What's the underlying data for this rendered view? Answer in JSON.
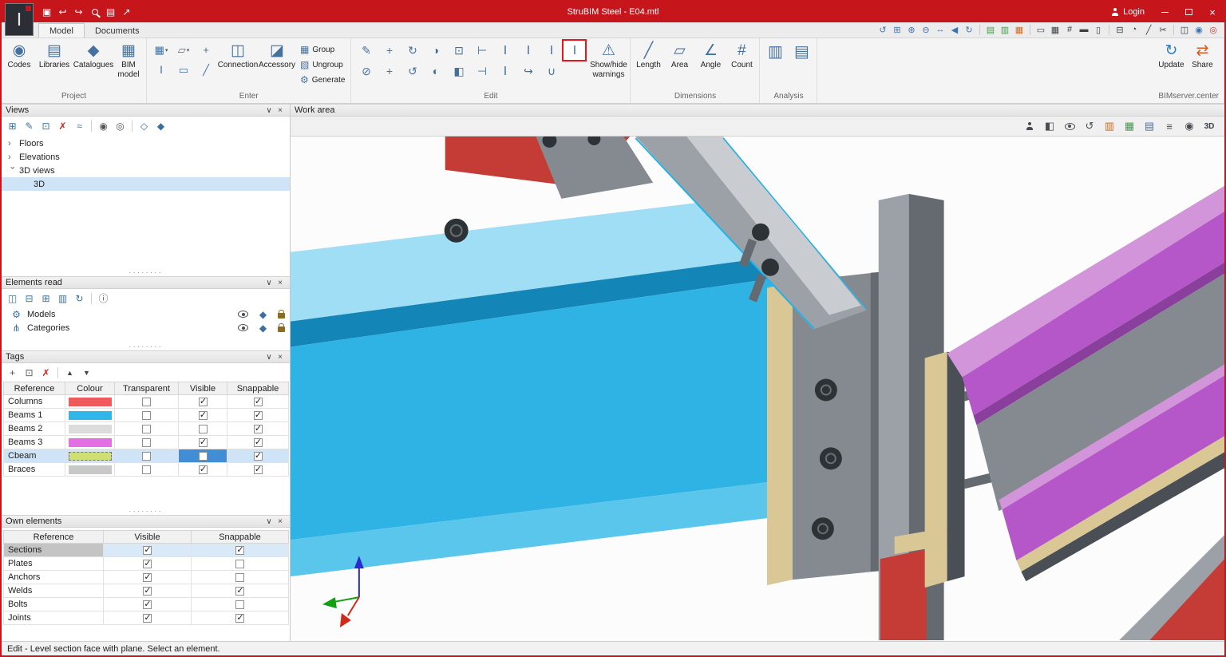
{
  "titlebar": {
    "title": "StruBIM Steel - E04.mtl",
    "login_label": "Login"
  },
  "tabs": {
    "model": "Model",
    "documents": "Documents"
  },
  "ribbon": {
    "project": {
      "label": "Project",
      "codes": "Codes",
      "libraries": "Libraries",
      "catalogues": "Catalogues",
      "bim_model": "BIM model"
    },
    "enter": {
      "label": "Enter",
      "connection": "Connection",
      "accessory": "Accessory",
      "group": "Group",
      "ungroup": "Ungroup",
      "generate": "Generate"
    },
    "edit": {
      "label": "Edit",
      "show_hide_warnings": "Show/hide warnings"
    },
    "dimensions": {
      "label": "Dimensions",
      "length": "Length",
      "area": "Area",
      "angle": "Angle",
      "count": "Count"
    },
    "analysis": {
      "label": "Analysis"
    },
    "bimserver": {
      "label": "BIMserver.center",
      "update": "Update",
      "share": "Share"
    }
  },
  "views_panel": {
    "title": "Views",
    "items": {
      "floors": "Floors",
      "elevations": "Elevations",
      "views3d": "3D views",
      "view3d": "3D"
    }
  },
  "elements_read_panel": {
    "title": "Elements read",
    "models": "Models",
    "categories": "Categories"
  },
  "tags_panel": {
    "title": "Tags",
    "columns": {
      "reference": "Reference",
      "colour": "Colour",
      "transparent": "Transparent",
      "visible": "Visible",
      "snappable": "Snappable"
    },
    "rows": [
      {
        "reference": "Columns",
        "colour": "#ef5a5c",
        "transparent": false,
        "visible": true,
        "snappable": true
      },
      {
        "reference": "Beams 1",
        "colour": "#2eb7e8",
        "transparent": false,
        "visible": true,
        "snappable": true
      },
      {
        "reference": "Beams 2",
        "colour": "#dcdcdc",
        "transparent": false,
        "visible": false,
        "snappable": true
      },
      {
        "reference": "Beams 3",
        "colour": "#e46fe4",
        "transparent": false,
        "visible": true,
        "snappable": true
      },
      {
        "reference": "Cbeam",
        "colour": "#cfe070",
        "transparent": false,
        "visible": false,
        "snappable": true
      },
      {
        "reference": "Braces",
        "colour": "#c8c8c8",
        "transparent": false,
        "visible": true,
        "snappable": true
      }
    ]
  },
  "own_elements_panel": {
    "title": "Own elements",
    "columns": {
      "reference": "Reference",
      "visible": "Visible",
      "snappable": "Snappable"
    },
    "rows": [
      {
        "reference": "Sections",
        "visible": true,
        "snappable": true
      },
      {
        "reference": "Plates",
        "visible": true,
        "snappable": false
      },
      {
        "reference": "Anchors",
        "visible": true,
        "snappable": false
      },
      {
        "reference": "Welds",
        "visible": true,
        "snappable": true
      },
      {
        "reference": "Bolts",
        "visible": true,
        "snappable": false
      },
      {
        "reference": "Joints",
        "visible": true,
        "snappable": true
      }
    ]
  },
  "workarea": {
    "title": "Work area",
    "view3d_label": "3D"
  },
  "statusbar": {
    "text": "Edit - Level section face with plane. Select an element."
  },
  "colors": {
    "titlebar": "#c6161c",
    "selection": "#cfe4f7",
    "cell_focus": "#418ed6",
    "row_current": "#c4c4c4",
    "row_current_rest": "#d9e9f7"
  },
  "viewport_colors": {
    "beam_top": "#9fdef4",
    "beam_shadow": "#1385b6",
    "beam_web": "#2fb3e4",
    "beam_bottom": "#5ac6ec",
    "plate_tan": "#d9c895",
    "steel_light": "#9ba1a7",
    "steel_mid": "#848a90",
    "steel_dark": "#646a70",
    "steel_deep": "#494f55",
    "channel_inner": "#c9cdd1",
    "magenta_top": "#d295da",
    "magenta": "#b557c9",
    "magenta_deep": "#8a3f9c",
    "red": "#c43c35",
    "bolt": "#2d3237",
    "edge_cyan": "#21b2e8",
    "axis_x": "#d02a1a",
    "axis_y": "#12a012",
    "axis_z": "#2a2ad0"
  },
  "icons": {
    "app": "Ⅰ",
    "save": "▣",
    "undo": "↩",
    "redo": "↪",
    "styles": "▤",
    "export": "↗",
    "close_x": "×",
    "collapse": "∨",
    "expander": "›",
    "caret": "▾",
    "orbit": "↺",
    "rotate": "↻",
    "zoom_window": "⊞",
    "zoom_in": "⊕",
    "zoom_out": "⊖",
    "pan": "↔",
    "prev": "◀",
    "sheet": "▤",
    "cells": "▥",
    "grid": "▦",
    "grid2": "▧",
    "rect": "▭",
    "hash": "#",
    "screen": "▬",
    "note": "▯",
    "tagbox": "◧",
    "compare": "⊟",
    "clock": "◔",
    "ruler": "╱",
    "cut": "✂",
    "layout": "◫",
    "globe": "◉",
    "rings": "◎",
    "add": "⊞",
    "edit": "✎",
    "copy": "⊡",
    "del": "✗",
    "section": "≈",
    "camera": "◉",
    "camera2": "◎",
    "cube_open": "◇",
    "cube": "◆",
    "refresh": "↻",
    "info": "ⓘ",
    "gear": "⚙",
    "branch": "⋔",
    "plus": "+",
    "up": "▲",
    "down": "▼",
    "beam": "Ⅰ",
    "slab": "▭",
    "plane": "▱",
    "boxes": "◫",
    "boxes2": "◪",
    "warn": "⚠",
    "angle": "∠",
    "pencil": "✎",
    "move": "+",
    "mirror": "◑",
    "mirror2": "◐",
    "rotate_ccw": "↺",
    "extend": "⊢",
    "dim": "⊣",
    "union": "∪",
    "redirect": "↪",
    "erase": "⊘",
    "eq": "≡",
    "swap": "⇄"
  }
}
